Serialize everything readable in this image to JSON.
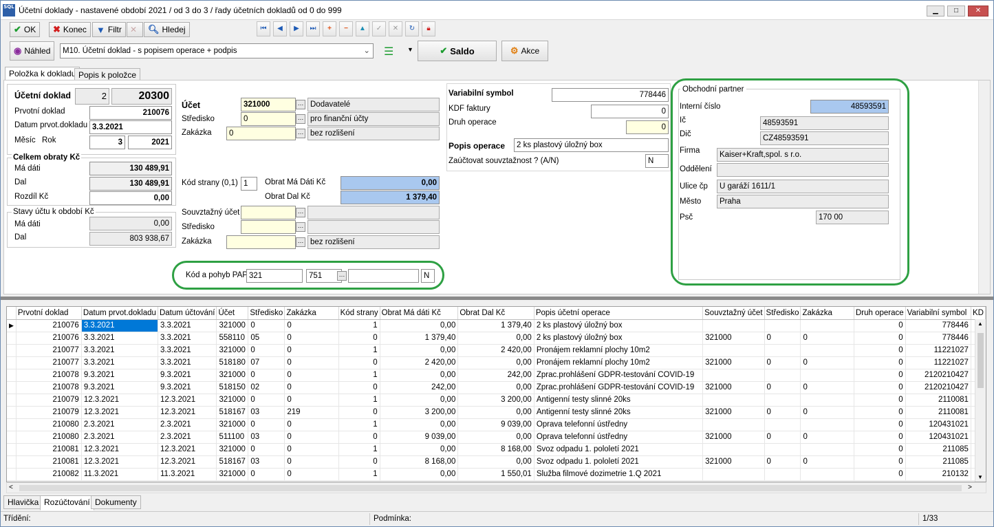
{
  "window": {
    "title": "Účetní doklady - nastavené období 2021 / od 3 do 3 / řady účetních dokladů od 0 do 999",
    "logo": "SQL"
  },
  "toolbar": {
    "ok": "OK",
    "konec": "Konec",
    "filtr": "Filtr",
    "hledej": "Hledej",
    "nahled": "Náhled",
    "report": "M10. Účetní doklad - s popisem operace + podpis",
    "saldo": "Saldo",
    "akce": "Akce"
  },
  "tabs": {
    "polozka": "Položka k dokladu",
    "popis": "Popis k položce"
  },
  "doc": {
    "ucetni_doklad_label": "Účetní doklad",
    "ucetni_doklad_series": "2",
    "ucetni_doklad_no": "20300",
    "prvotni_label": "Prvotní doklad",
    "prvotni": "210076",
    "datum_label": "Datum prvot.dokladu",
    "datum": "3.3.2021",
    "mesic_label": "Měsíc",
    "rok_label": "Rok",
    "mesic": "3",
    "rok": "2021"
  },
  "obraty": {
    "title": "Celkem obraty Kč",
    "ma_dati_label": "Má dáti",
    "ma_dati": "130 489,91",
    "dal_label": "Dal",
    "dal": "130 489,91",
    "rozdil_label": "Rozdíl Kč",
    "rozdil": "0,00"
  },
  "stavy": {
    "title": "Stavy účtu k období Kč",
    "ma_dati_label": "Má dáti",
    "ma_dati": "0,00",
    "dal_label": "Dal",
    "dal": "803 938,67"
  },
  "ucet": {
    "ucet_label": "Účet",
    "ucet": "321000",
    "ucet_name": "Dodavatelé",
    "stredisko_label": "Středisko",
    "stredisko": "0",
    "stredisko_name": "pro finanční účty",
    "zakazka_label": "Zakázka",
    "zakazka": "0",
    "zakazka_name": "bez rozlišení",
    "kod_strany_label": "Kód strany (0,1)",
    "kod_strany": "1",
    "obrat_md_label": "Obrat Má Dáti Kč",
    "obrat_md": "0,00",
    "obrat_dal_label": "Obrat Dal Kč",
    "obrat_dal": "1 379,40",
    "souv_ucet_label": "Souvztažný účet",
    "souv_stredisko_label": "Středisko",
    "souv_zakazka_label": "Zakázka",
    "souv_zakazka_name": "bez rozlišení"
  },
  "pap": {
    "label": "Kód a pohyb PAP",
    "kod": "321",
    "pohyb": "751",
    "flag": "N"
  },
  "mid": {
    "vs_label": "Variabilní symbol",
    "vs": "778446",
    "kdf_label": "KDF faktury",
    "kdf": "0",
    "druh_label": "Druh operace",
    "druh": "0",
    "popis_label": "Popis operace",
    "popis": "2 ks plastový úložný box",
    "zauct_label": "Zaúčtovat souvztažnost ? (A/N)",
    "zauct": "N"
  },
  "partner": {
    "title": "Obchodní partner",
    "interni_label": "Interní číslo",
    "interni": "48593591",
    "ic_label": "Ič",
    "ic": "48593591",
    "dic_label": "Dič",
    "dic": "CZ48593591",
    "firma_label": "Firma",
    "firma": "Kaiser+Kraft,spol. s r.o.",
    "oddeleni_label": "Oddělení",
    "oddeleni": "",
    "ulice_label": "Ulice čp",
    "ulice": "U garáží 1611/1",
    "mesto_label": "Město",
    "mesto": "Praha",
    "psc_label": "Psč",
    "psc": "170 00"
  },
  "grid": {
    "columns": [
      "Prvotní doklad",
      "Datum prvot.dokladu",
      "Datum účtování",
      "Účet",
      "Středisko",
      "Zakázka",
      "Kód strany",
      "Obrat Má dáti Kč",
      "Obrat Dal Kč",
      "Popis účetní operace",
      "Souvztažný účet",
      "Středisko",
      "Zakázka",
      "Druh operace",
      "Variabilní symbol",
      "KD"
    ],
    "rows": [
      [
        "210076",
        "3.3.2021",
        "3.3.2021",
        "321000",
        "0",
        "0",
        "1",
        "0,00",
        "1 379,40",
        "2 ks plastový úložný box",
        "",
        "",
        "",
        "0",
        "778446"
      ],
      [
        "210076",
        "3.3.2021",
        "3.3.2021",
        "558110",
        "05",
        "0",
        "0",
        "1 379,40",
        "0,00",
        "2 ks plastový úložný box",
        "321000",
        "0",
        "0",
        "0",
        "778446"
      ],
      [
        "210077",
        "3.3.2021",
        "3.3.2021",
        "321000",
        "0",
        "0",
        "1",
        "0,00",
        "2 420,00",
        "Pronájem reklamní plochy 10m2",
        "",
        "",
        "",
        "0",
        "11221027"
      ],
      [
        "210077",
        "3.3.2021",
        "3.3.2021",
        "518180",
        "07",
        "0",
        "0",
        "2 420,00",
        "0,00",
        "Pronájem reklamní plochy 10m2",
        "321000",
        "0",
        "0",
        "0",
        "11221027"
      ],
      [
        "210078",
        "9.3.2021",
        "9.3.2021",
        "321000",
        "0",
        "0",
        "1",
        "0,00",
        "242,00",
        "Zprac.prohlášení GDPR-testování COVID-19",
        "",
        "",
        "",
        "0",
        "2120210427"
      ],
      [
        "210078",
        "9.3.2021",
        "9.3.2021",
        "518150",
        "02",
        "0",
        "0",
        "242,00",
        "0,00",
        "Zprac.prohlášení GDPR-testování COVID-19",
        "321000",
        "0",
        "0",
        "0",
        "2120210427"
      ],
      [
        "210079",
        "12.3.2021",
        "12.3.2021",
        "321000",
        "0",
        "0",
        "1",
        "0,00",
        "3 200,00",
        "Antigenní testy slinné 20ks",
        "",
        "",
        "",
        "0",
        "2110081"
      ],
      [
        "210079",
        "12.3.2021",
        "12.3.2021",
        "518167",
        "03",
        "219",
        "0",
        "3 200,00",
        "0,00",
        "Antigenní testy slinné 20ks",
        "321000",
        "0",
        "0",
        "0",
        "2110081"
      ],
      [
        "210080",
        "2.3.2021",
        "2.3.2021",
        "321000",
        "0",
        "0",
        "1",
        "0,00",
        "9 039,00",
        "Oprava telefonní ústředny",
        "",
        "",
        "",
        "0",
        "120431021"
      ],
      [
        "210080",
        "2.3.2021",
        "2.3.2021",
        "511100",
        "03",
        "0",
        "0",
        "9 039,00",
        "0,00",
        "Oprava telefonní ústředny",
        "321000",
        "0",
        "0",
        "0",
        "120431021"
      ],
      [
        "210081",
        "12.3.2021",
        "12.3.2021",
        "321000",
        "0",
        "0",
        "1",
        "0,00",
        "8 168,00",
        "Svoz odpadu 1. pololetí 2021",
        "",
        "",
        "",
        "0",
        "211085"
      ],
      [
        "210081",
        "12.3.2021",
        "12.3.2021",
        "518167",
        "03",
        "0",
        "0",
        "8 168,00",
        "0,00",
        "Svoz odpadu 1. pololetí 2021",
        "321000",
        "0",
        "0",
        "0",
        "211085"
      ],
      [
        "210082",
        "11.3.2021",
        "11.3.2021",
        "321000",
        "0",
        "0",
        "1",
        "0,00",
        "1 550,01",
        "Služba filmové dozimetrie 1.Q 2021",
        "",
        "",
        "",
        "0",
        "210132"
      ]
    ]
  },
  "bottom_tabs": [
    "Hlavička",
    "Rozúčtování",
    "Dokumenty"
  ],
  "status": {
    "trideni": "Třídění:",
    "podminka": "Podmínka:",
    "count": "1/33"
  },
  "colors": {
    "highlight_green": "#2ea043",
    "selection": "#0078d7",
    "blue_field": "#a9c8ef",
    "yellow_field": "#ffffe1"
  }
}
